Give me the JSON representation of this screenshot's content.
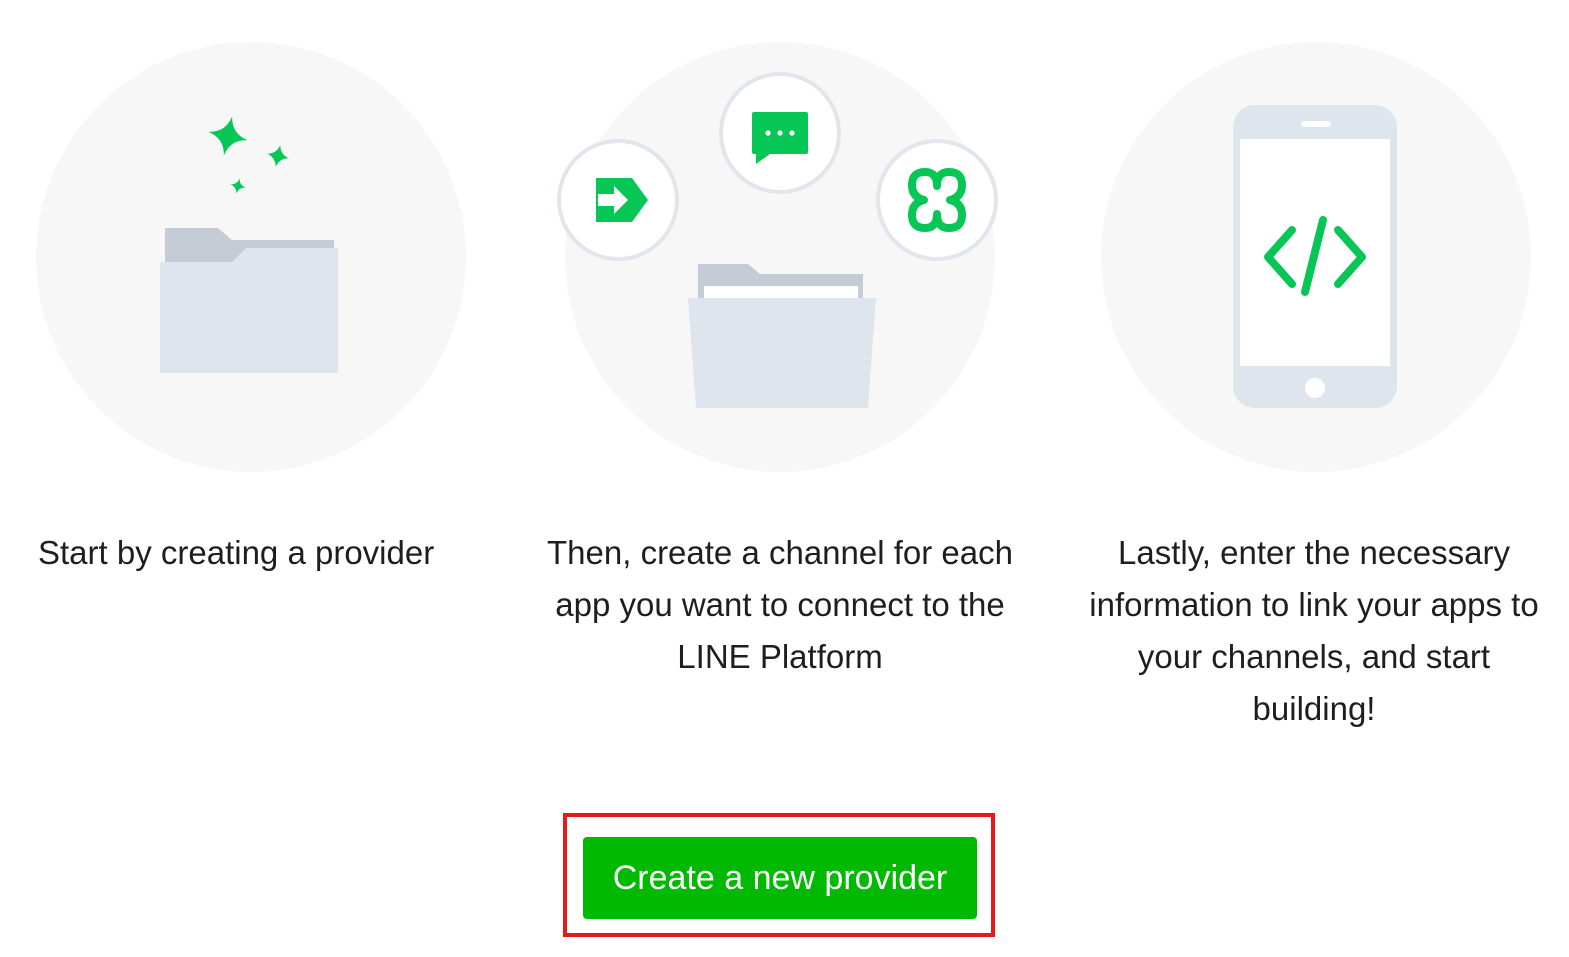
{
  "steps": [
    {
      "caption": "Start by creating a provider",
      "icons": [
        "sparkle-icon",
        "folder-icon"
      ]
    },
    {
      "caption": "Then, create a channel for each app you want to connect to the LINE Platform",
      "icons": [
        "login-arrow-icon",
        "chat-bubble-icon",
        "clover-icon",
        "open-folder-icon"
      ]
    },
    {
      "caption": "Lastly, enter the necessary information to link your apps to your channels, and start building!",
      "icons": [
        "smartphone-icon",
        "code-icon"
      ]
    }
  ],
  "cta": {
    "label": "Create a new provider"
  },
  "colors": {
    "brand_green": "#00b900",
    "icon_green": "#06c755",
    "highlight_red": "#e51b1b",
    "circle_bg": "#f7f7f7",
    "folder_light": "#dfe5ec",
    "folder_dark": "#c5ccd5"
  }
}
